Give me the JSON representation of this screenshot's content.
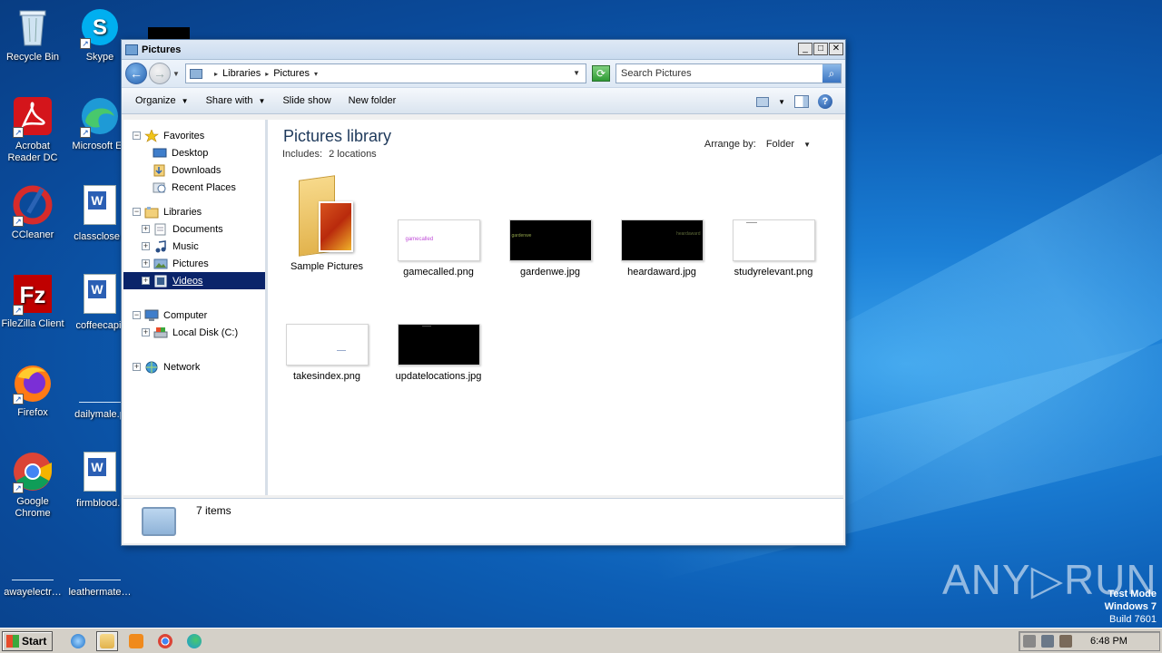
{
  "desktop": {
    "icons": [
      {
        "label": "Recycle Bin",
        "icon": "recycle-bin-icon"
      },
      {
        "label": "Skype",
        "icon": "skype-icon"
      },
      {
        "label": "Acrobat Reader DC",
        "icon": "acrobat-icon"
      },
      {
        "label": "Microsoft Ed",
        "icon": "edge-icon"
      },
      {
        "label": "CCleaner",
        "icon": "ccleaner-icon"
      },
      {
        "label": "classclose.r",
        "icon": "word-doc-icon"
      },
      {
        "label": "FileZilla Client",
        "icon": "filezilla-icon"
      },
      {
        "label": "coffeecapit",
        "icon": "word-doc-icon"
      },
      {
        "label": "Firefox",
        "icon": "firefox-icon"
      },
      {
        "label": "dailymale.p",
        "icon": "blank-file-icon"
      },
      {
        "label": "Google Chrome",
        "icon": "chrome-icon"
      },
      {
        "label": "firmblood.r",
        "icon": "word-doc-icon"
      },
      {
        "label": "awayelectr…",
        "icon": "blank-file-icon"
      },
      {
        "label": "leathermate…",
        "icon": "blank-file-icon"
      }
    ]
  },
  "window": {
    "title": "Pictures",
    "controls": {
      "minimize": "_",
      "maximize": "□",
      "close": "✕"
    },
    "address": {
      "crumbs": [
        "Libraries",
        "Pictures"
      ]
    },
    "search": {
      "placeholder": "Search Pictures"
    },
    "toolbar": {
      "organize": "Organize",
      "share_with": "Share with",
      "slide_show": "Slide show",
      "new_folder": "New folder"
    },
    "nav": {
      "favorites": "Favorites",
      "desktop": "Desktop",
      "downloads": "Downloads",
      "recent_places": "Recent Places",
      "libraries": "Libraries",
      "documents": "Documents",
      "music": "Music",
      "pictures": "Pictures",
      "videos": "Videos",
      "computer": "Computer",
      "local_disk": "Local Disk (C:)",
      "network": "Network"
    },
    "library": {
      "title": "Pictures library",
      "includes_label": "Includes:",
      "includes_value": "2 locations",
      "arrange_label": "Arrange by:",
      "arrange_value": "Folder"
    },
    "files": [
      {
        "name": "Sample Pictures",
        "kind": "folder"
      },
      {
        "name": "gamecalled.png",
        "thumb_text": "gamecalled",
        "thumb_bg": "#ffffff",
        "thumb_fg": "#c04dd8"
      },
      {
        "name": "gardenwe.jpg",
        "thumb_text": "gardenwe",
        "thumb_bg": "#000000",
        "thumb_fg": "#8ea04a"
      },
      {
        "name": "heardaward.jpg",
        "thumb_text": "heardaward",
        "thumb_bg": "#000000",
        "thumb_fg": "#5f6b3a"
      },
      {
        "name": "studyrelevant.png",
        "thumb_text": "",
        "thumb_bg": "#ffffff",
        "thumb_fg": "#999999"
      },
      {
        "name": "takesindex.png",
        "thumb_text": "",
        "thumb_bg": "#ffffff",
        "thumb_fg": "#99aacc"
      },
      {
        "name": "updatelocations.jpg",
        "thumb_text": "",
        "thumb_bg": "#000000",
        "thumb_fg": "#555555"
      }
    ],
    "status": {
      "count": "7 items"
    }
  },
  "watermark": {
    "brand": "ANY▷RUN",
    "line1": "Test Mode",
    "line2": "Windows 7",
    "line3": "Build 7601"
  },
  "taskbar": {
    "start": "Start",
    "time": "6:48 PM"
  }
}
